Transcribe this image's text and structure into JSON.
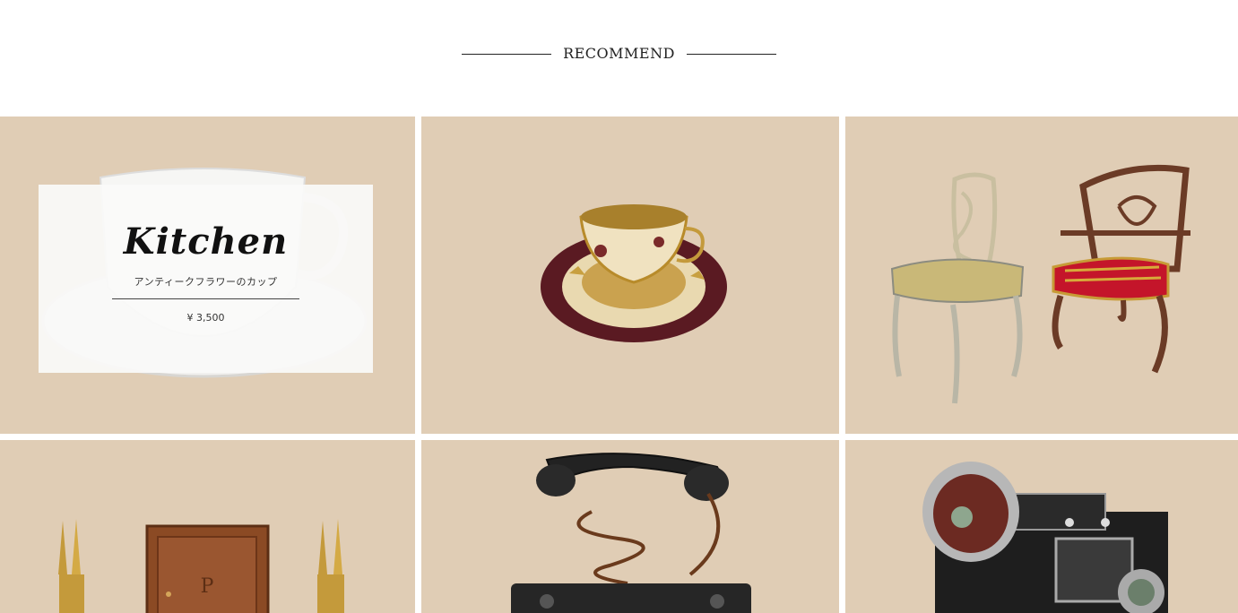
{
  "section": {
    "heading": "RECOMMEND"
  },
  "products": [
    {
      "category": "Kitchen",
      "name": "アンティークフラワーのカップ",
      "price": "¥ 3,500",
      "image": "floral-teacup-image"
    },
    {
      "image": "gold-burgundy-teacup-image"
    },
    {
      "image": "antique-chairs-image"
    },
    {
      "image": "wooden-cabinet-candlesticks-image"
    },
    {
      "image": "antique-telephone-image"
    },
    {
      "image": "vintage-camera-image"
    }
  ],
  "colors": {
    "tile_background": "#e0cdb5",
    "card_background": "#fafaf9",
    "text": "#222222"
  }
}
